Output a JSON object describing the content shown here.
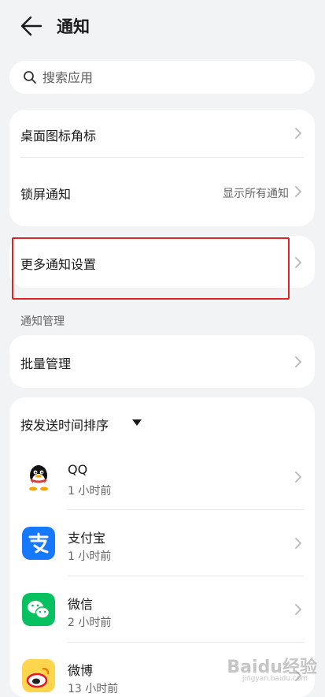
{
  "header": {
    "title": "通知",
    "back_icon": "arrow-left-icon"
  },
  "search": {
    "placeholder": "搜索应用",
    "value": ""
  },
  "card1": {
    "items": [
      {
        "label": "桌面图标角标",
        "value": ""
      },
      {
        "label": "锁屏通知",
        "value": "显示所有通知"
      }
    ]
  },
  "card2": {
    "label": "更多通知设置"
  },
  "section": {
    "label": "通知管理"
  },
  "card3": {
    "label": "批量管理"
  },
  "apps": {
    "sort_label": "按发送时间排序",
    "items": [
      {
        "name": "QQ",
        "time": "1 小时前",
        "icon": "qq-icon"
      },
      {
        "name": "支付宝",
        "time": "1 小时前",
        "icon": "alipay-icon"
      },
      {
        "name": "微信",
        "time": "2 小时前",
        "icon": "wechat-icon"
      },
      {
        "name": "微博",
        "time": "13 小时前",
        "icon": "weibo-icon"
      }
    ]
  },
  "watermark": {
    "text": "Baidu经验",
    "sub": "jingyan.baidu.com"
  },
  "colors": {
    "background": "#f1f3f5",
    "highlight": "#e02424",
    "alipay": "#1677ff",
    "wechat": "#07c160"
  }
}
